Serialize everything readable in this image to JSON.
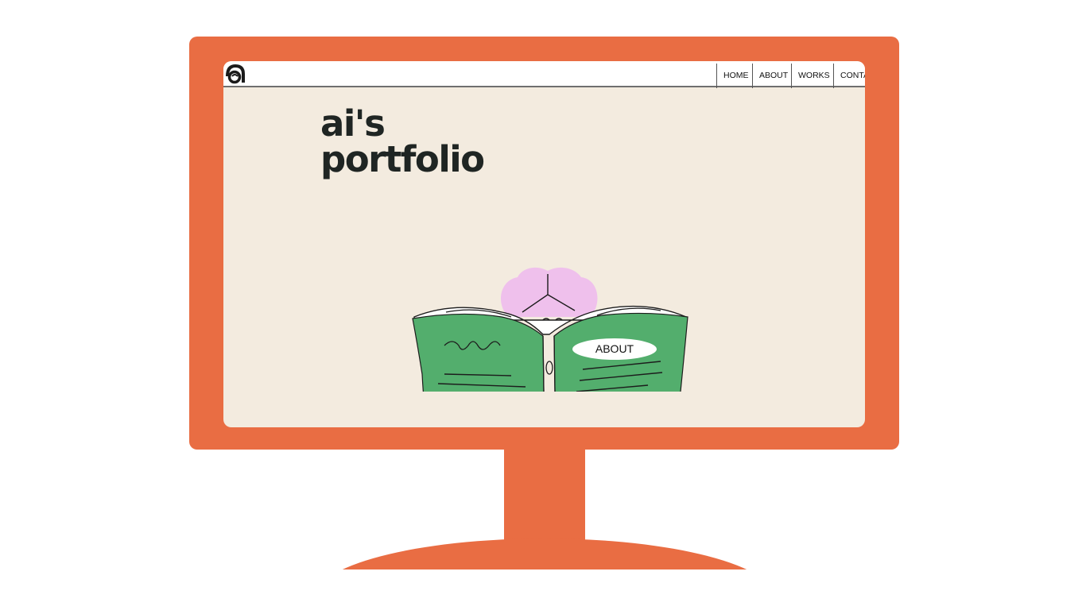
{
  "site": {
    "logo_letter": "a",
    "nav": {
      "home": "HOME",
      "about": "ABOUT",
      "works": "WORKS",
      "contact": "CONTACT"
    },
    "title_line1": "ai's",
    "title_line2": "portfolio",
    "about_button": "ABOUT"
  },
  "colors": {
    "monitor": "#e96d43",
    "screen_bg": "#f3ebdf",
    "book_green": "#53ae6d",
    "hair_pink": "#efc0ec",
    "ink": "#1f2523"
  },
  "icons": {
    "logo": "a-logo-icon",
    "illustration": "person-reading-book"
  }
}
